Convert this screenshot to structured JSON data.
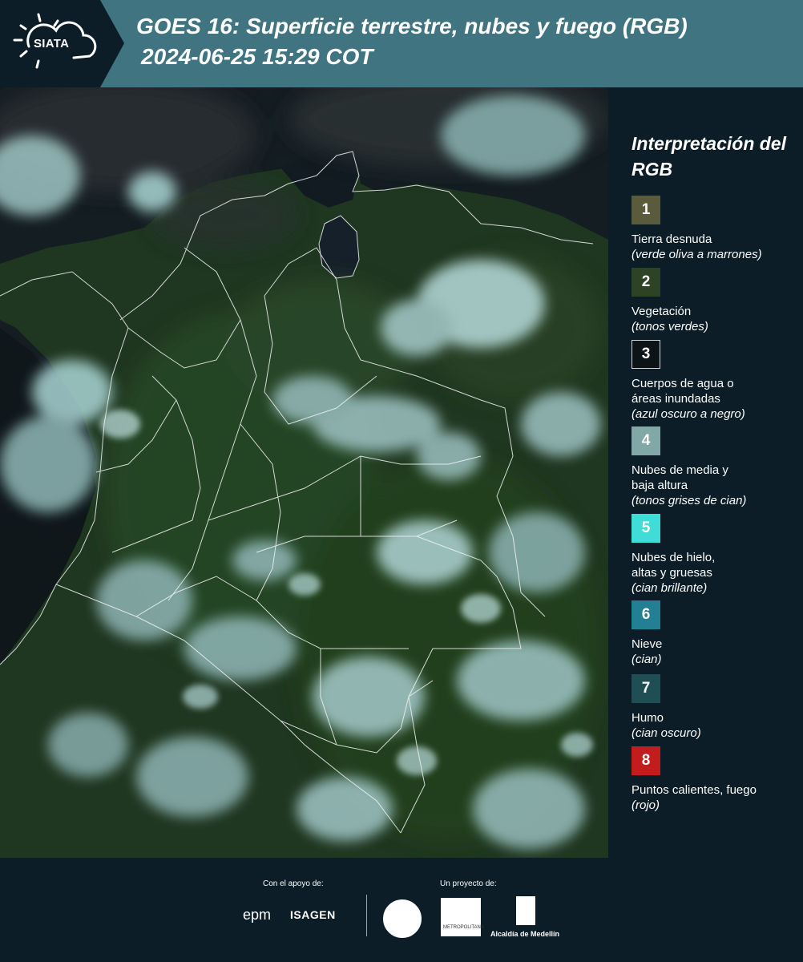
{
  "header": {
    "logo_text": "SIATA",
    "title_line1": "GOES 16: Superficie terrestre, nubes y fuego (RGB)",
    "title_line2": "2024-06-25 15:29 COT",
    "logo_icon": "sun-cloud-icon"
  },
  "legend": {
    "title": "Interpretación del RGB",
    "items": [
      {
        "number": "1",
        "color": "#5a5a3d",
        "label": "Tierra desnuda",
        "sub": "(verde oliva a marrones)"
      },
      {
        "number": "2",
        "color": "#2e4324",
        "label": "Vegetación",
        "sub": "(tonos verdes)"
      },
      {
        "number": "3",
        "color": "#0c1418",
        "label": "Cuerpos de agua o áreas inundadas",
        "sub": "(azul oscuro a negro)"
      },
      {
        "number": "4",
        "color": "#82a7a7",
        "label": "Nubes de media y baja altura",
        "sub": "(tonos grises de cian)"
      },
      {
        "number": "5",
        "color": "#3fdcd8",
        "label": "Nubes de hielo, altas y gruesas",
        "sub": "(cian brillante)"
      },
      {
        "number": "6",
        "color": "#237f93",
        "label": "Nieve",
        "sub": "(cian)"
      },
      {
        "number": "7",
        "color": "#1f4f55",
        "label": "Humo",
        "sub": "(cian oscuro)"
      },
      {
        "number": "8",
        "color": "#c21c1c",
        "label": "Puntos calientes, fuego",
        "sub": "(rojo)"
      }
    ]
  },
  "footer": {
    "support_label": "Con el apoyo de:",
    "project_label": "Un proyecto de:",
    "epm": "epm",
    "isagen": "ISAGEN",
    "area_text": "METROPOLITANA",
    "alcaldia": "Alcaldía de Medellín"
  }
}
